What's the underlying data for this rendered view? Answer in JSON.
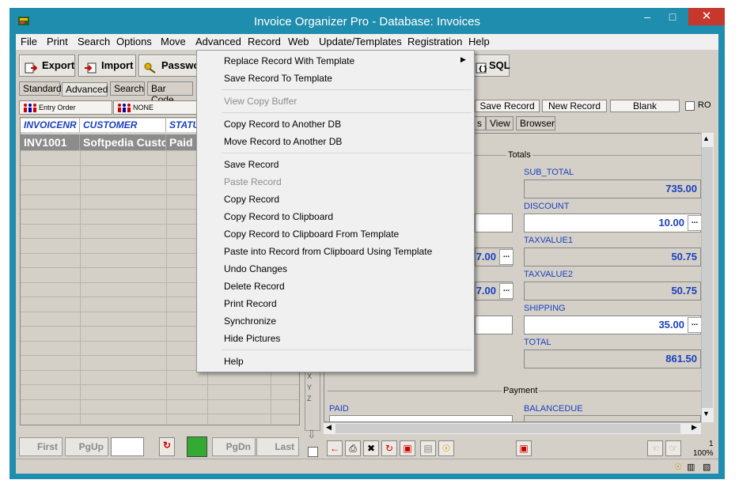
{
  "window": {
    "title": "Invoice Organizer Pro - Database: Invoices",
    "minimize": "–",
    "maximize": "□",
    "close": "✕",
    "colors": {
      "titlebar": "#1f8dad",
      "close": "#c7372b",
      "accent": "#1a3fbf"
    }
  },
  "menu": [
    "File",
    "Print",
    "Search",
    "Options",
    "Move",
    "Advanced",
    "Record",
    "Web",
    "Update/Templates",
    "Registration",
    "Help"
  ],
  "toolbar": {
    "export": "Export",
    "import": "Import",
    "password": "Password",
    "sql": "SQL"
  },
  "left_tabs": [
    "Standard",
    "Advanced",
    "Search",
    "Bar Code"
  ],
  "sort": {
    "order1": "Entry Order",
    "order2": "NONE"
  },
  "grid": {
    "columns": [
      "INVOICENR",
      "CUSTOMER",
      "STATUS"
    ],
    "rows": [
      {
        "invoicenr": "INV1001",
        "customer": "Softpedia Customer",
        "status": "Paid"
      }
    ]
  },
  "nav": {
    "first": "First",
    "pgup": "PgUp",
    "pgdn": "PgDn",
    "last": "Last"
  },
  "record_buttons": {
    "save": "Save Record",
    "new": "New Record",
    "blank": "Blank",
    "ro": "RO"
  },
  "record_tabs": [
    "s",
    "View",
    "Browser"
  ],
  "alpha": [
    "X",
    "Y",
    "Z"
  ],
  "totals": {
    "group": "Totals",
    "sub_total_label": "SUB_TOTAL",
    "sub_total": "735.00",
    "discount_label": "DISCOUNT",
    "discount": "10.00",
    "tax1_label": "TAXVALUE1",
    "tax1": "50.75",
    "tax2_label": "TAXVALUE2",
    "tax2": "50.75",
    "shipping_label": "SHIPPING",
    "shipping": "35.00",
    "total_label": "TOTAL",
    "total": "861.50",
    "left_val1": "7.00",
    "left_val2": "7.00"
  },
  "payment": {
    "group": "Payment",
    "paid_label": "PAID",
    "balance_label": "BALANCEDUE"
  },
  "zoom": "100%",
  "zoom_top": "1",
  "context_menu": {
    "items": [
      {
        "label": "Replace Record With Template",
        "disabled": false,
        "submenu": true
      },
      {
        "label": "Save Record To Template",
        "disabled": false
      },
      {
        "sep": true
      },
      {
        "label": "View Copy Buffer",
        "disabled": true
      },
      {
        "sep": true
      },
      {
        "label": "Copy Record to Another DB",
        "disabled": false
      },
      {
        "label": "Move Record to Another DB",
        "disabled": false
      },
      {
        "sep": true
      },
      {
        "label": "Save Record",
        "disabled": false
      },
      {
        "label": "Paste Record",
        "disabled": true
      },
      {
        "label": "Copy Record",
        "disabled": false
      },
      {
        "label": "Copy Record to Clipboard",
        "disabled": false
      },
      {
        "label": "Copy Record to Clipboard From Template",
        "disabled": false
      },
      {
        "label": "Paste into Record from Clipboard Using Template",
        "disabled": false
      },
      {
        "label": "Undo Changes",
        "disabled": false
      },
      {
        "label": "Delete Record",
        "disabled": false
      },
      {
        "label": "Print Record",
        "disabled": false
      },
      {
        "label": "Synchronize",
        "disabled": false
      },
      {
        "label": "Hide Pictures",
        "disabled": false
      },
      {
        "sep": true
      },
      {
        "label": "Help",
        "disabled": false
      }
    ]
  }
}
